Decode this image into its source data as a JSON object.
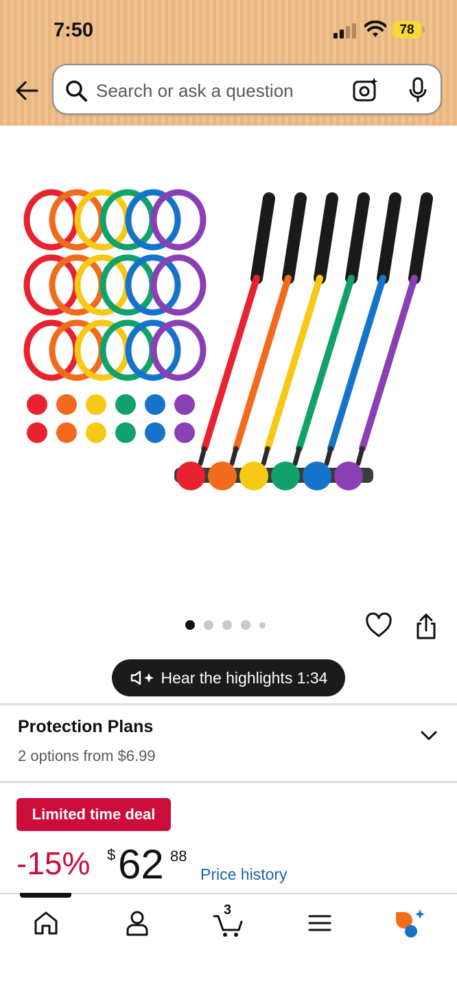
{
  "status_bar": {
    "time": "7:50",
    "battery": "78"
  },
  "search": {
    "placeholder": "Search or ask a question"
  },
  "gallery": {
    "dots_total": 5,
    "active_index": 0
  },
  "audio": {
    "label": "Hear the highlights 1:34"
  },
  "protection": {
    "title": "Protection Plans",
    "subtitle": "2 options from $6.99"
  },
  "deal": {
    "badge": "Limited time deal",
    "discount": "-15%",
    "currency": "$",
    "price_whole": "62",
    "price_fraction": "88",
    "price_history_link": "Price history"
  },
  "bottom_nav": {
    "cart_count": "3"
  },
  "colors": {
    "header_bg": "#eab77f",
    "deal_red": "#cc0c39",
    "link_blue": "#2162a1",
    "product_colors": [
      "#e8232f",
      "#f26b1d",
      "#f7c914",
      "#10a26a",
      "#1673cc",
      "#8a3fb5"
    ]
  }
}
